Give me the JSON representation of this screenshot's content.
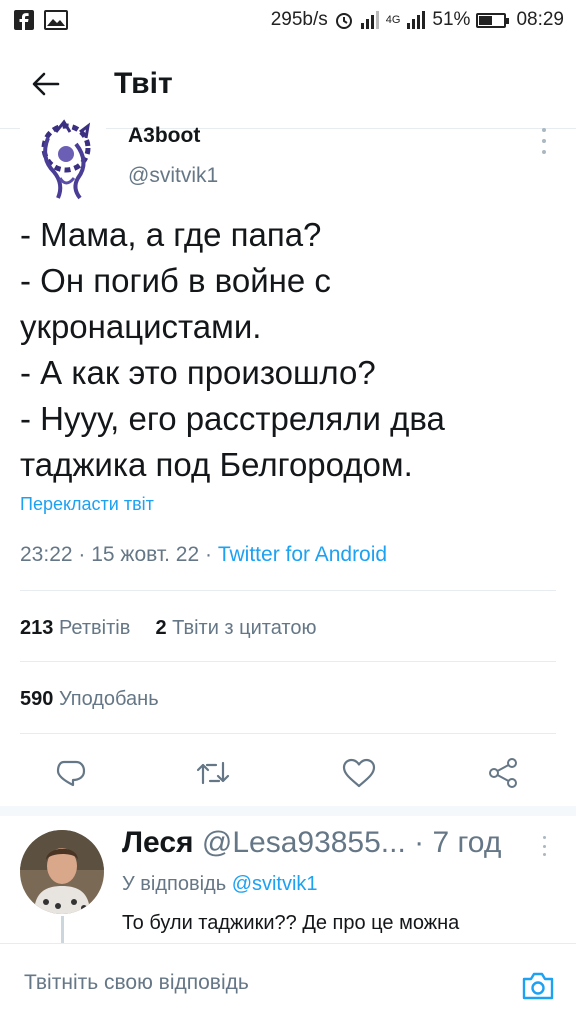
{
  "status_bar": {
    "network_speed": "295b/s",
    "network_type": "4G",
    "battery_percent": "51%",
    "battery_level": 0.51,
    "time": "08:29",
    "left_icons": [
      "facebook-icon",
      "image-icon"
    ],
    "right_icons": [
      "alarm-icon",
      "signal-icon",
      "signal-4g-icon",
      "battery-icon"
    ]
  },
  "header": {
    "title": "Твіт",
    "back_icon": "arrow-left-icon"
  },
  "tweet": {
    "author_name": "A3boot",
    "author_handle": "@svitvik1",
    "text_lines": [
      "- Мама, а где папа?",
      "- Он погиб в войне с",
      "укронацистами.",
      "- А как это произошло?",
      "- Нууу, его расстреляли два",
      "таджика под Белгородом."
    ],
    "translate_link": "Перекласти твіт",
    "time": "23:22",
    "date": "15 жовт. 22",
    "source": "Twitter for Android",
    "retweets_count": "213",
    "retweets_label": "Ретвітів",
    "quotes_count": "2",
    "quotes_label": "Твіти з цитатою",
    "likes_count": "590",
    "likes_label": "Уподобань"
  },
  "actions": [
    {
      "name": "reply",
      "icon": "comment-icon"
    },
    {
      "name": "retweet",
      "icon": "retweet-icon"
    },
    {
      "name": "like",
      "icon": "heart-icon"
    },
    {
      "name": "share",
      "icon": "share-icon"
    }
  ],
  "reply": {
    "author_name": "Леся",
    "author_handle": "@Lesa93855...",
    "separator": "·",
    "time_ago": "7 год",
    "replying_to_label": "У відповідь",
    "replying_to_handle": "@svitvik1",
    "text": "То були таджики?? Де про це можна"
  },
  "compose": {
    "placeholder": "Твітніть свою відповідь",
    "camera_icon": "camera-icon"
  },
  "colors": {
    "accent": "#1da1f2",
    "secondary_text": "#657786",
    "primary_text": "#14171a",
    "divider": "#e6ecf0"
  }
}
